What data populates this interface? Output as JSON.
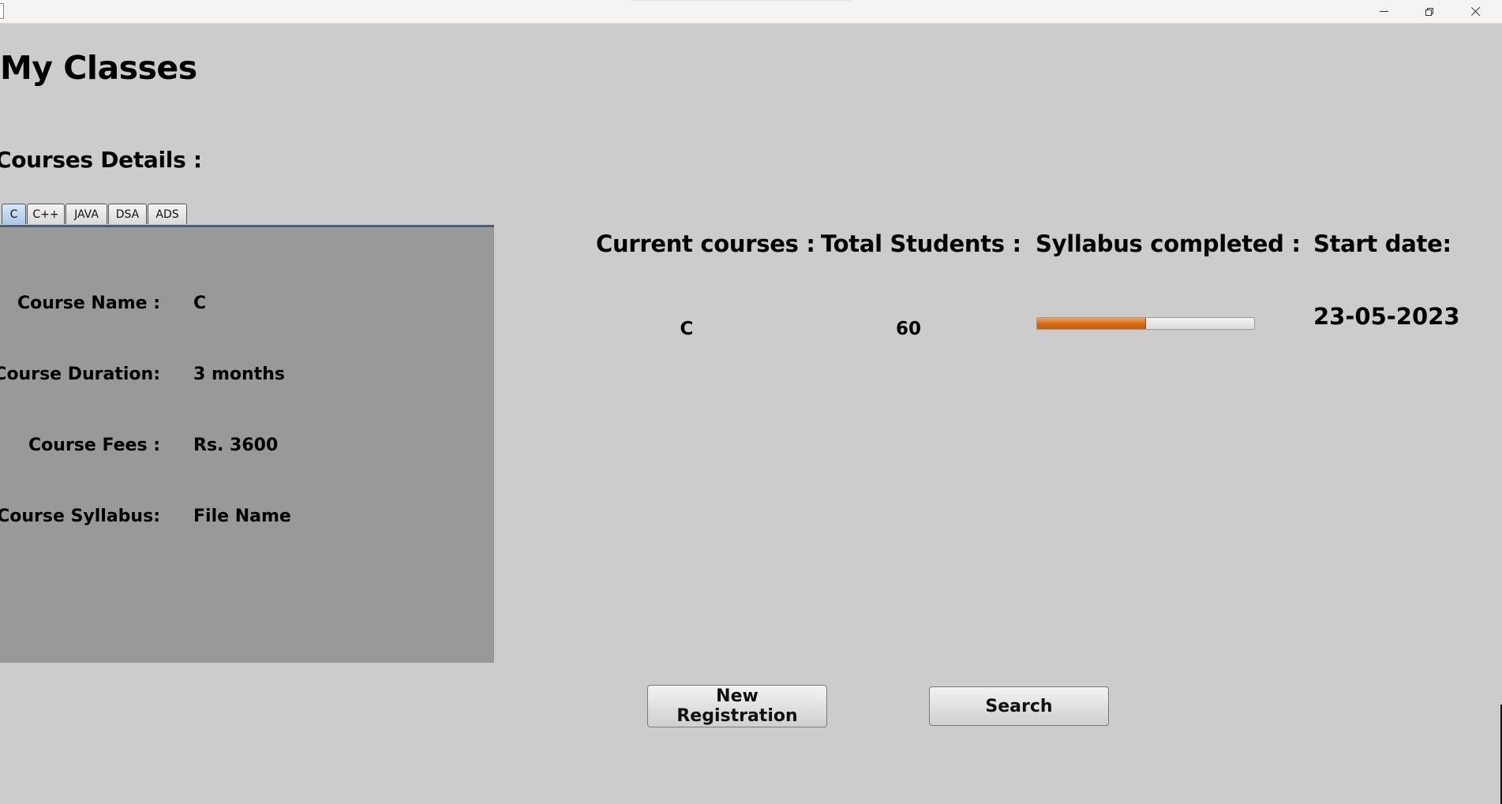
{
  "window": {
    "minimize_label": "Minimize",
    "maximize_label": "Restore",
    "close_label": "Close"
  },
  "page": {
    "title": "My Classes"
  },
  "courses_section": {
    "title": "Courses Details :"
  },
  "tabs": [
    {
      "label": "C",
      "active": true
    },
    {
      "label": "C++",
      "active": false
    },
    {
      "label": "JAVA",
      "active": false
    },
    {
      "label": "DSA",
      "active": false
    },
    {
      "label": "ADS",
      "active": false
    }
  ],
  "details": {
    "name_label": "Course Name :",
    "name_value": "C",
    "duration_label": "Course Duration:",
    "duration_value": "3 months",
    "fees_label": "Course Fees :",
    "fees_value": "Rs. 3600",
    "syllabus_label": "Course Syllabus:",
    "syllabus_value": "File Name"
  },
  "summary": {
    "current_courses_label": "Current courses :",
    "current_courses_value": "C",
    "total_students_label": "Total Students :",
    "total_students_value": "60",
    "syllabus_completed_label": "Syllabus completed :",
    "syllabus_completed_fraction": 0.5,
    "start_date_label": "Start date:",
    "start_date_value": "23-05-2023"
  },
  "buttons": {
    "new_registration": "New Registration",
    "search": "Search"
  },
  "colors": {
    "background": "#cccccc",
    "panel": "#999999",
    "progress_accent": "#d46a10",
    "active_tab": "#a9c8e6"
  }
}
